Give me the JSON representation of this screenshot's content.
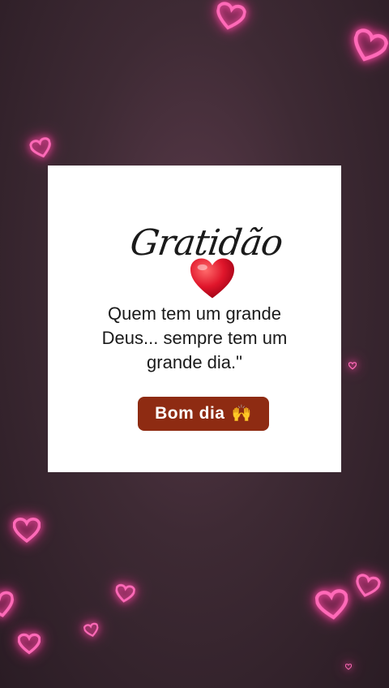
{
  "card": {
    "script_title": "Gratidão",
    "quote": "Quem tem um grande\nDeus... sempre tem um\ngrande dia.\"",
    "button_label": "Bom dia",
    "button_icon": "raised-hands-icon",
    "button_emoji": "🙌"
  },
  "colors": {
    "background": "#3e2a34",
    "heart_glow": "#ff4fa8",
    "button": "#8e2b12",
    "red_heart": "#e0162b"
  }
}
